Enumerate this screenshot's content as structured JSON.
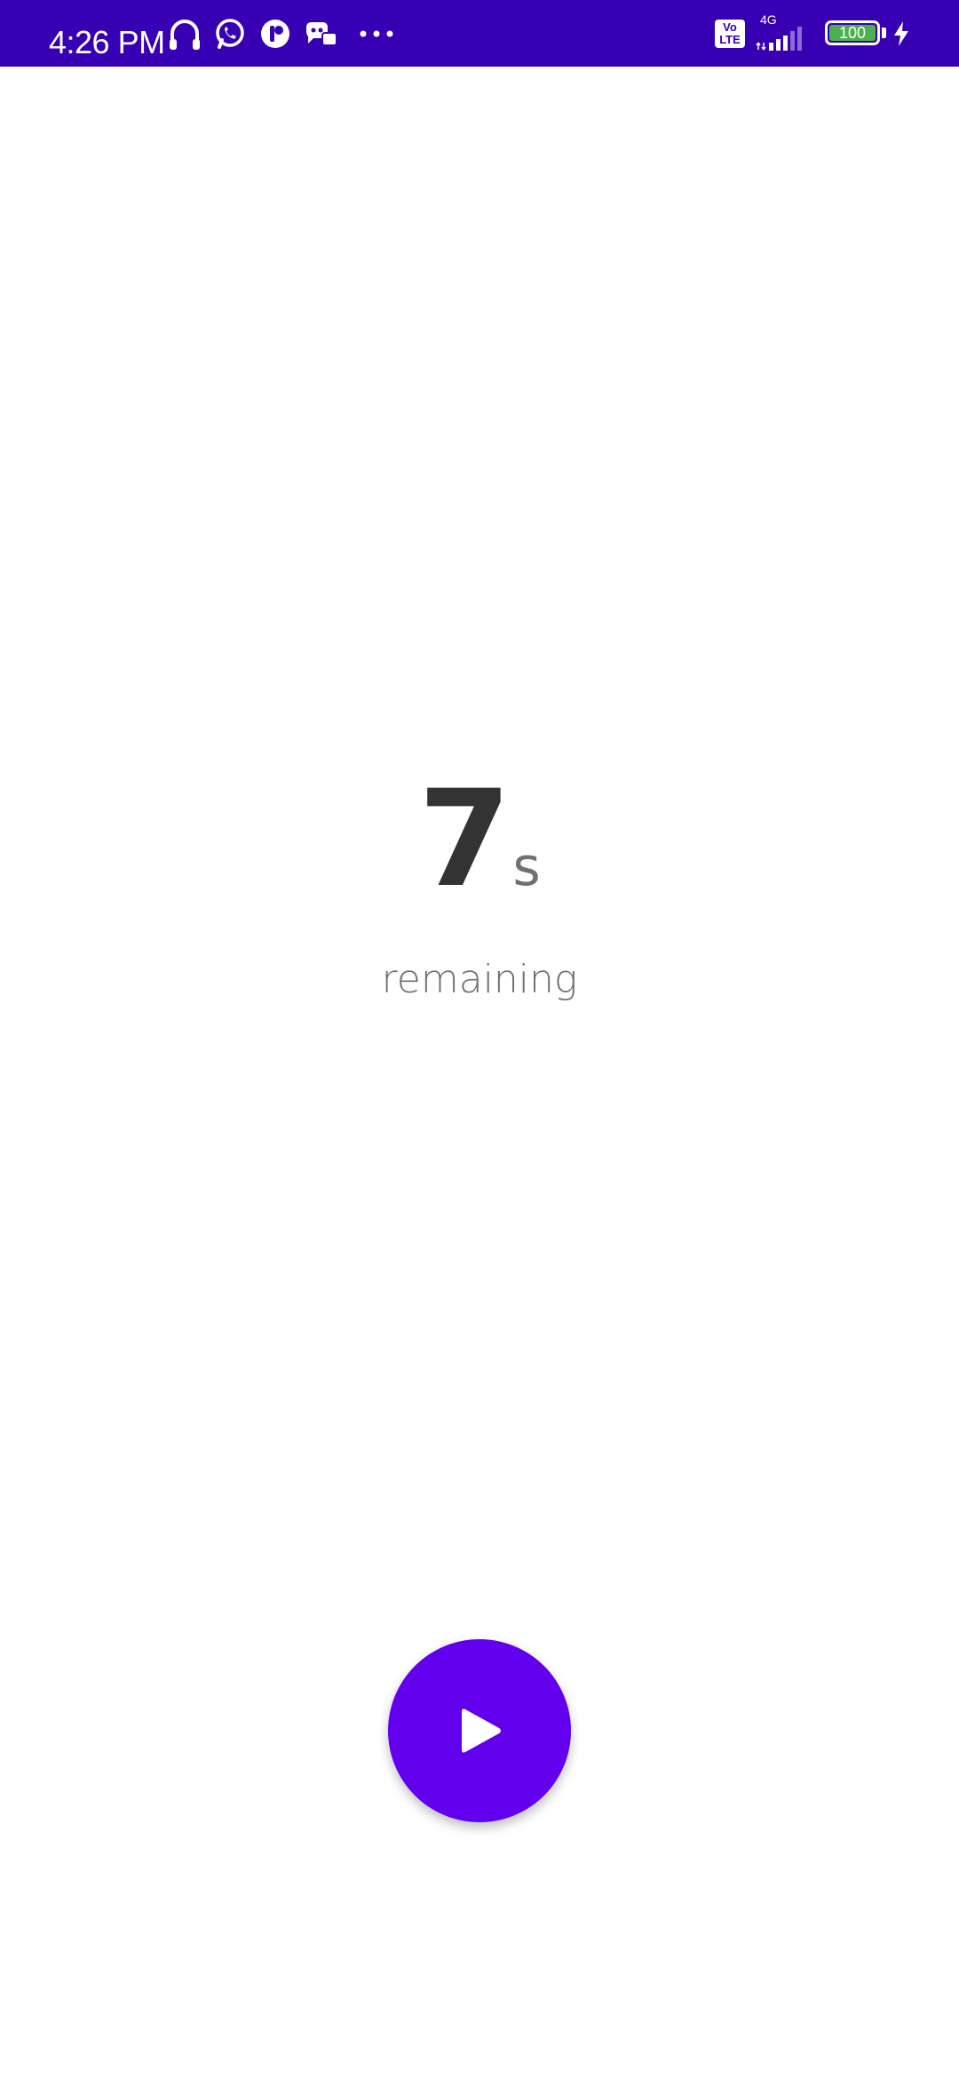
{
  "status_bar": {
    "time": "4:26 PM",
    "network_type": "4G",
    "volte_label_top": "Vo",
    "volte_label_bottom": "LTE",
    "battery_level": "100",
    "background_color": "#3700b3",
    "notification_icons": [
      "headphones-icon",
      "whatsapp-icon",
      "app-notification-icon",
      "game-controller-icon",
      "more-dots-icon"
    ]
  },
  "timer": {
    "value": "7",
    "unit": "s",
    "label": "remaining"
  },
  "controls": {
    "play_icon": "play-icon",
    "accent_color": "#6200ee"
  }
}
